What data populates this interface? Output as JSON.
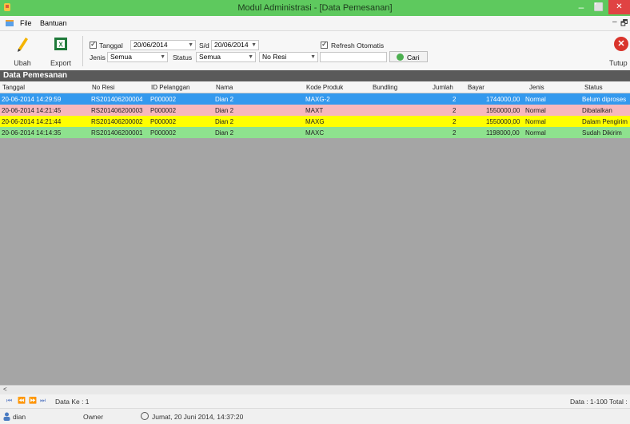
{
  "window": {
    "title": "Modul Administrasi - [Data Pemesanan]",
    "controls": {
      "min": "–",
      "max": "⬜",
      "close": "✕"
    }
  },
  "menu": {
    "items": [
      "File",
      "Bantuan"
    ],
    "mdi_controls": {
      "min": "–",
      "restore": "🗗"
    }
  },
  "toolbar": {
    "ubah_label": "Ubah",
    "export_label": "Export",
    "tutup_label": "Tutup"
  },
  "filters": {
    "tanggal_label": "Tanggal",
    "tanggal_from": "20/06/2014",
    "sd_label": "S/d",
    "tanggal_to": "20/06/2014",
    "refresh_label": "Refresh Otomatis",
    "jenis_label": "Jenis",
    "jenis_value": "Semua",
    "status_label": "Status",
    "status_value": "Semua",
    "search_field_value": "No Resi",
    "search_text": "",
    "cari_label": "Cari"
  },
  "section": {
    "title": "Data Pemesanan"
  },
  "table": {
    "columns": [
      "Tanggal",
      "No Resi",
      "ID Pelanggan",
      "Nama",
      "Kode Produk",
      "Bundling",
      "Jumlah",
      "Bayar",
      "Jenis",
      "Status"
    ],
    "rows": [
      {
        "tanggal": "20-06-2014 14:29:59",
        "resi": "RS201406200004",
        "pelanggan": "P000002",
        "nama": "Dian 2",
        "kode": "MAXG-2",
        "bundling": "",
        "jumlah": "2",
        "bayar": "1744000,00",
        "jenis": "Normal",
        "status": "Belum diproses",
        "color": "#3399ee"
      },
      {
        "tanggal": "20-06-2014 14:21:45",
        "resi": "RS201406200003",
        "pelanggan": "P000002",
        "nama": "Dian 2",
        "kode": "MAXT",
        "bundling": "",
        "jumlah": "2",
        "bayar": "1550000,00",
        "jenis": "Normal",
        "status": "Dibatalkan",
        "color": "#f7b8bd"
      },
      {
        "tanggal": "20-06-2014 14:21:44",
        "resi": "RS201406200002",
        "pelanggan": "P000002",
        "nama": "Dian 2",
        "kode": "MAXG",
        "bundling": "",
        "jumlah": "2",
        "bayar": "1550000,00",
        "jenis": "Normal",
        "status": "Dalam Pengirim",
        "color": "#ffff00"
      },
      {
        "tanggal": "20-06-2014 14:14:35",
        "resi": "RS201406200001",
        "pelanggan": "P000002",
        "nama": "Dian 2",
        "kode": "MAXC",
        "bundling": "",
        "jumlah": "2",
        "bayar": "1198000,00",
        "jenis": "Normal",
        "status": "Sudah Dikirim",
        "color": "#8ee28e"
      }
    ]
  },
  "navigator": {
    "data_ke": "Data Ke : 1",
    "data_range": "Data : 1-100 Total :"
  },
  "status": {
    "user": "dian",
    "role": "Owner",
    "datetime": "Jumat, 20 Juni 2014, 14:37:20"
  }
}
